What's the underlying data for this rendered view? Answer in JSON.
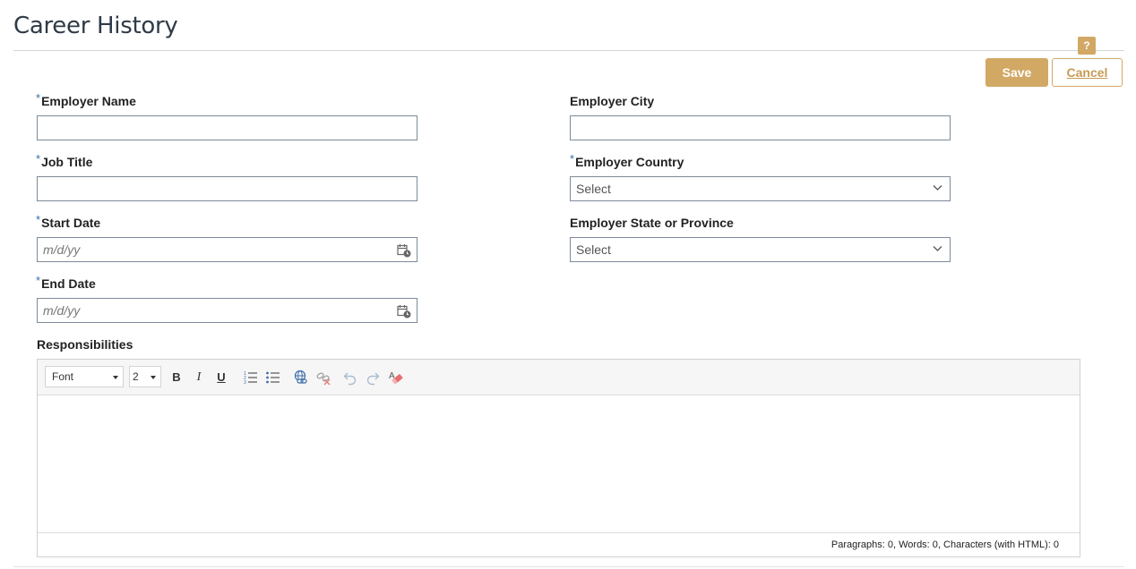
{
  "page": {
    "title": "Career History"
  },
  "actions": {
    "help_label": "?",
    "save_label": "Save",
    "cancel_label": "Cancel"
  },
  "colors": {
    "accent": "#d2a865",
    "required_marker": "#3a6ea8",
    "field_border": "#7d8b99"
  },
  "form": {
    "required_marker": "*",
    "employer_name": {
      "label": "Employer Name",
      "value": ""
    },
    "job_title": {
      "label": "Job Title",
      "value": ""
    },
    "start_date": {
      "label": "Start Date",
      "placeholder": "m/d/yy",
      "icon": "calendar-icon"
    },
    "end_date": {
      "label": "End Date",
      "placeholder": "m/d/yy",
      "icon": "calendar-icon"
    },
    "employer_city": {
      "label": "Employer City",
      "value": ""
    },
    "employer_country": {
      "label": "Employer Country",
      "selected": "Select"
    },
    "employer_state": {
      "label": "Employer State or Province",
      "selected": "Select"
    },
    "responsibilities": {
      "label": "Responsibilities"
    }
  },
  "editor": {
    "font_select": "Font",
    "size_select": "2",
    "toolbar_icons": [
      "bold-icon",
      "italic-icon",
      "underline-icon",
      "ordered-list-icon",
      "unordered-list-icon",
      "link-icon",
      "unlink-icon",
      "undo-icon",
      "redo-icon",
      "clear-format-icon"
    ],
    "bold_label": "B",
    "italic_label": "I",
    "underline_label": "U",
    "status_text": "Paragraphs: 0, Words: 0, Characters (with HTML): 0"
  }
}
